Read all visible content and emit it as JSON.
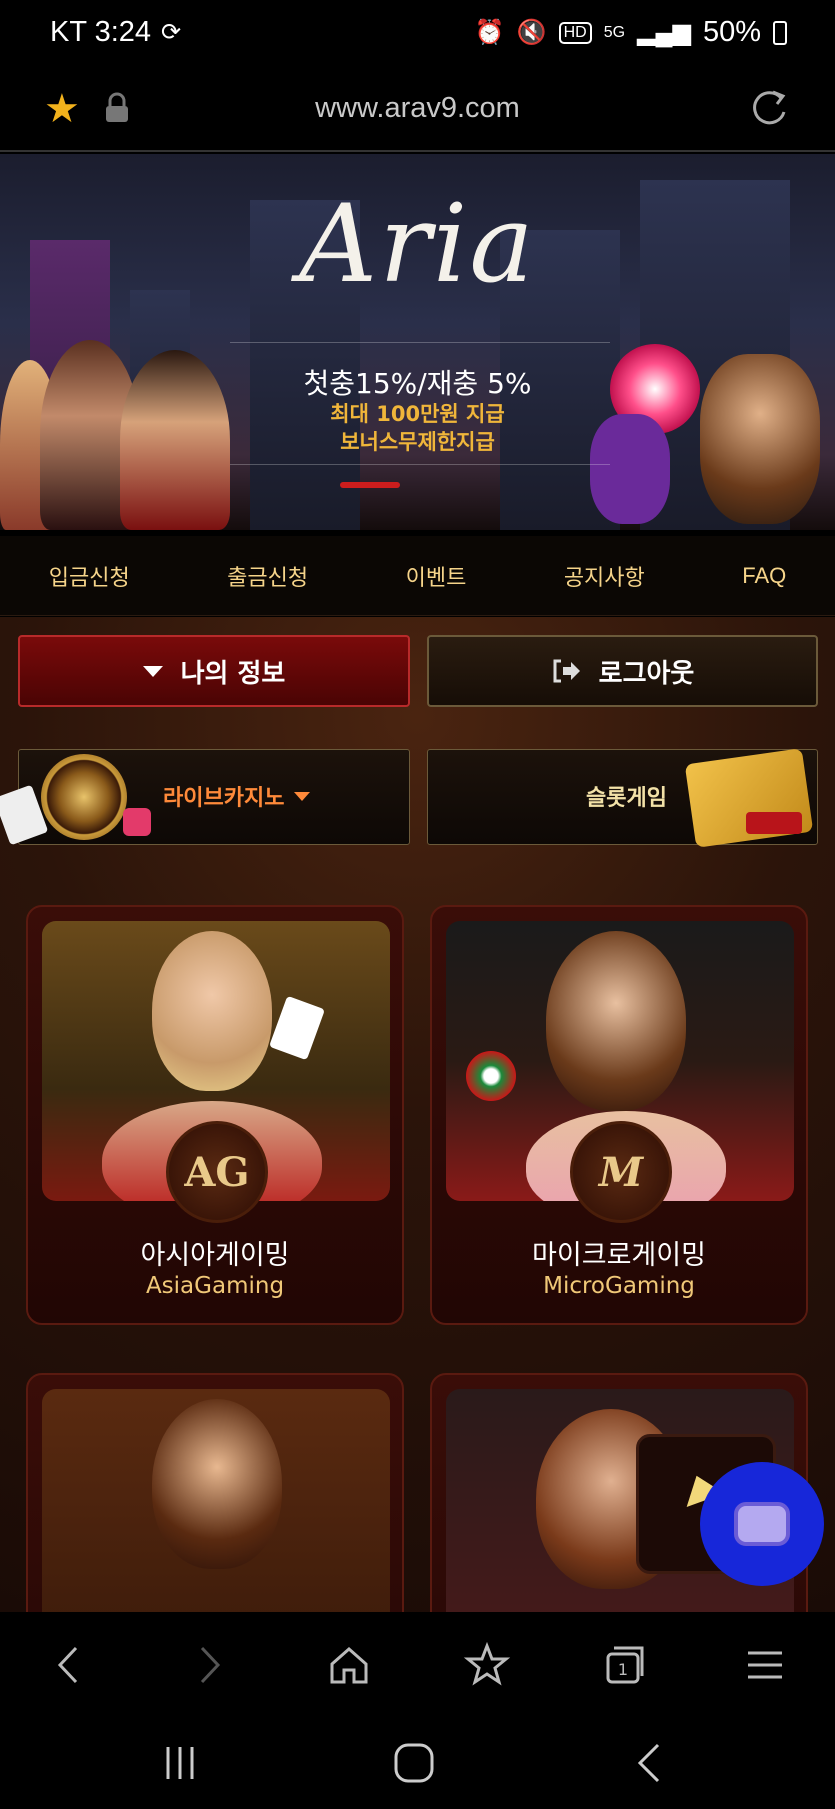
{
  "status_bar": {
    "carrier_time": "KT 3:24",
    "battery": "50%"
  },
  "browser": {
    "url": "www.arav9.com"
  },
  "hero": {
    "logo": "Aria",
    "promo_line1": "첫충15%/재충 5%",
    "promo_line2": "최대 100만원 지급",
    "promo_line3": "보너스무제한지급"
  },
  "nav": {
    "items": [
      {
        "label": "입금신청"
      },
      {
        "label": "출금신청"
      },
      {
        "label": "이벤트"
      },
      {
        "label": "공지사항"
      },
      {
        "label": "FAQ"
      }
    ]
  },
  "account": {
    "my_info_label": "나의 정보",
    "logout_label": "로그아웃"
  },
  "categories": {
    "live_casino": "라이브카지노",
    "slot_game": "슬롯게임"
  },
  "providers": [
    {
      "name_ko": "아시아게이밍",
      "name_en": "AsiaGaming",
      "badge": "AG"
    },
    {
      "name_ko": "마이크로게이밍",
      "name_en": "MicroGaming",
      "badge": "M"
    }
  ],
  "colors": {
    "accent_gold": "#f0c878",
    "accent_red": "#7a0a0a",
    "chat_blue": "#1727d9"
  }
}
